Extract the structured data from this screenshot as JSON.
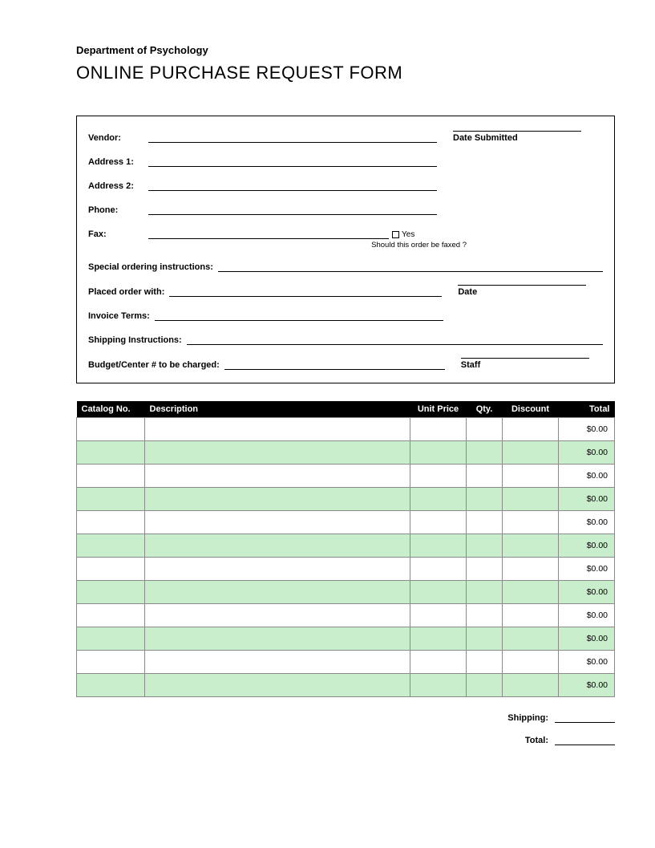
{
  "header": {
    "department": "Department of Psychology",
    "title": "ONLINE PURCHASE REQUEST FORM"
  },
  "vendor": {
    "vendor_label": "Vendor:",
    "address1_label": "Address 1:",
    "address2_label": "Address 2:",
    "phone_label": "Phone:",
    "fax_label": "Fax:",
    "fax_yes_label": "Yes",
    "fax_hint": "Should this order be faxed ?",
    "date_submitted_label": "Date Submitted",
    "special_label": "Special ordering instructions:",
    "placed_with_label": "Placed order with:",
    "date_label": "Date",
    "invoice_terms_label": "Invoice Terms:",
    "shipping_instructions_label": "Shipping Instructions:",
    "budget_label": "Budget/Center # to be charged:",
    "staff_label": "Staff"
  },
  "table": {
    "headers": {
      "catalog": "Catalog No.",
      "description": "Description",
      "unit_price": "Unit Price",
      "qty": "Qty.",
      "discount": "Discount",
      "total": "Total"
    },
    "rows": [
      {
        "catalog": "",
        "description": "",
        "unit_price": "",
        "qty": "",
        "discount": "",
        "total": "$0.00"
      },
      {
        "catalog": "",
        "description": "",
        "unit_price": "",
        "qty": "",
        "discount": "",
        "total": "$0.00"
      },
      {
        "catalog": "",
        "description": "",
        "unit_price": "",
        "qty": "",
        "discount": "",
        "total": "$0.00"
      },
      {
        "catalog": "",
        "description": "",
        "unit_price": "",
        "qty": "",
        "discount": "",
        "total": "$0.00"
      },
      {
        "catalog": "",
        "description": "",
        "unit_price": "",
        "qty": "",
        "discount": "",
        "total": "$0.00"
      },
      {
        "catalog": "",
        "description": "",
        "unit_price": "",
        "qty": "",
        "discount": "",
        "total": "$0.00"
      },
      {
        "catalog": "",
        "description": "",
        "unit_price": "",
        "qty": "",
        "discount": "",
        "total": "$0.00"
      },
      {
        "catalog": "",
        "description": "",
        "unit_price": "",
        "qty": "",
        "discount": "",
        "total": "$0.00"
      },
      {
        "catalog": "",
        "description": "",
        "unit_price": "",
        "qty": "",
        "discount": "",
        "total": "$0.00"
      },
      {
        "catalog": "",
        "description": "",
        "unit_price": "",
        "qty": "",
        "discount": "",
        "total": "$0.00"
      },
      {
        "catalog": "",
        "description": "",
        "unit_price": "",
        "qty": "",
        "discount": "",
        "total": "$0.00"
      },
      {
        "catalog": "",
        "description": "",
        "unit_price": "",
        "qty": "",
        "discount": "",
        "total": "$0.00"
      }
    ]
  },
  "footer": {
    "shipping_label": "Shipping:",
    "shipping_value": "",
    "total_label": "Total:",
    "total_value": ""
  }
}
